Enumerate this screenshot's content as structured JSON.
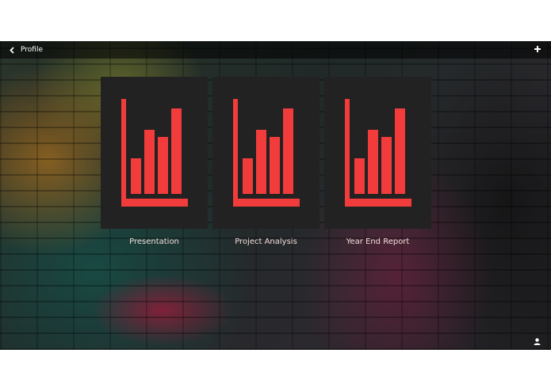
{
  "header": {
    "back_label": "Profile"
  },
  "icons": {
    "back": "chevron-left-icon",
    "add": "plus-icon",
    "user": "user-icon",
    "tile": "bar-chart-icon"
  },
  "colors": {
    "accent": "#f23b3b",
    "tile_background": "#232222",
    "label": "#f2dcd8"
  },
  "tiles": [
    {
      "label": "Presentation"
    },
    {
      "label": "Project Analysis"
    },
    {
      "label": "Year End Report"
    }
  ]
}
